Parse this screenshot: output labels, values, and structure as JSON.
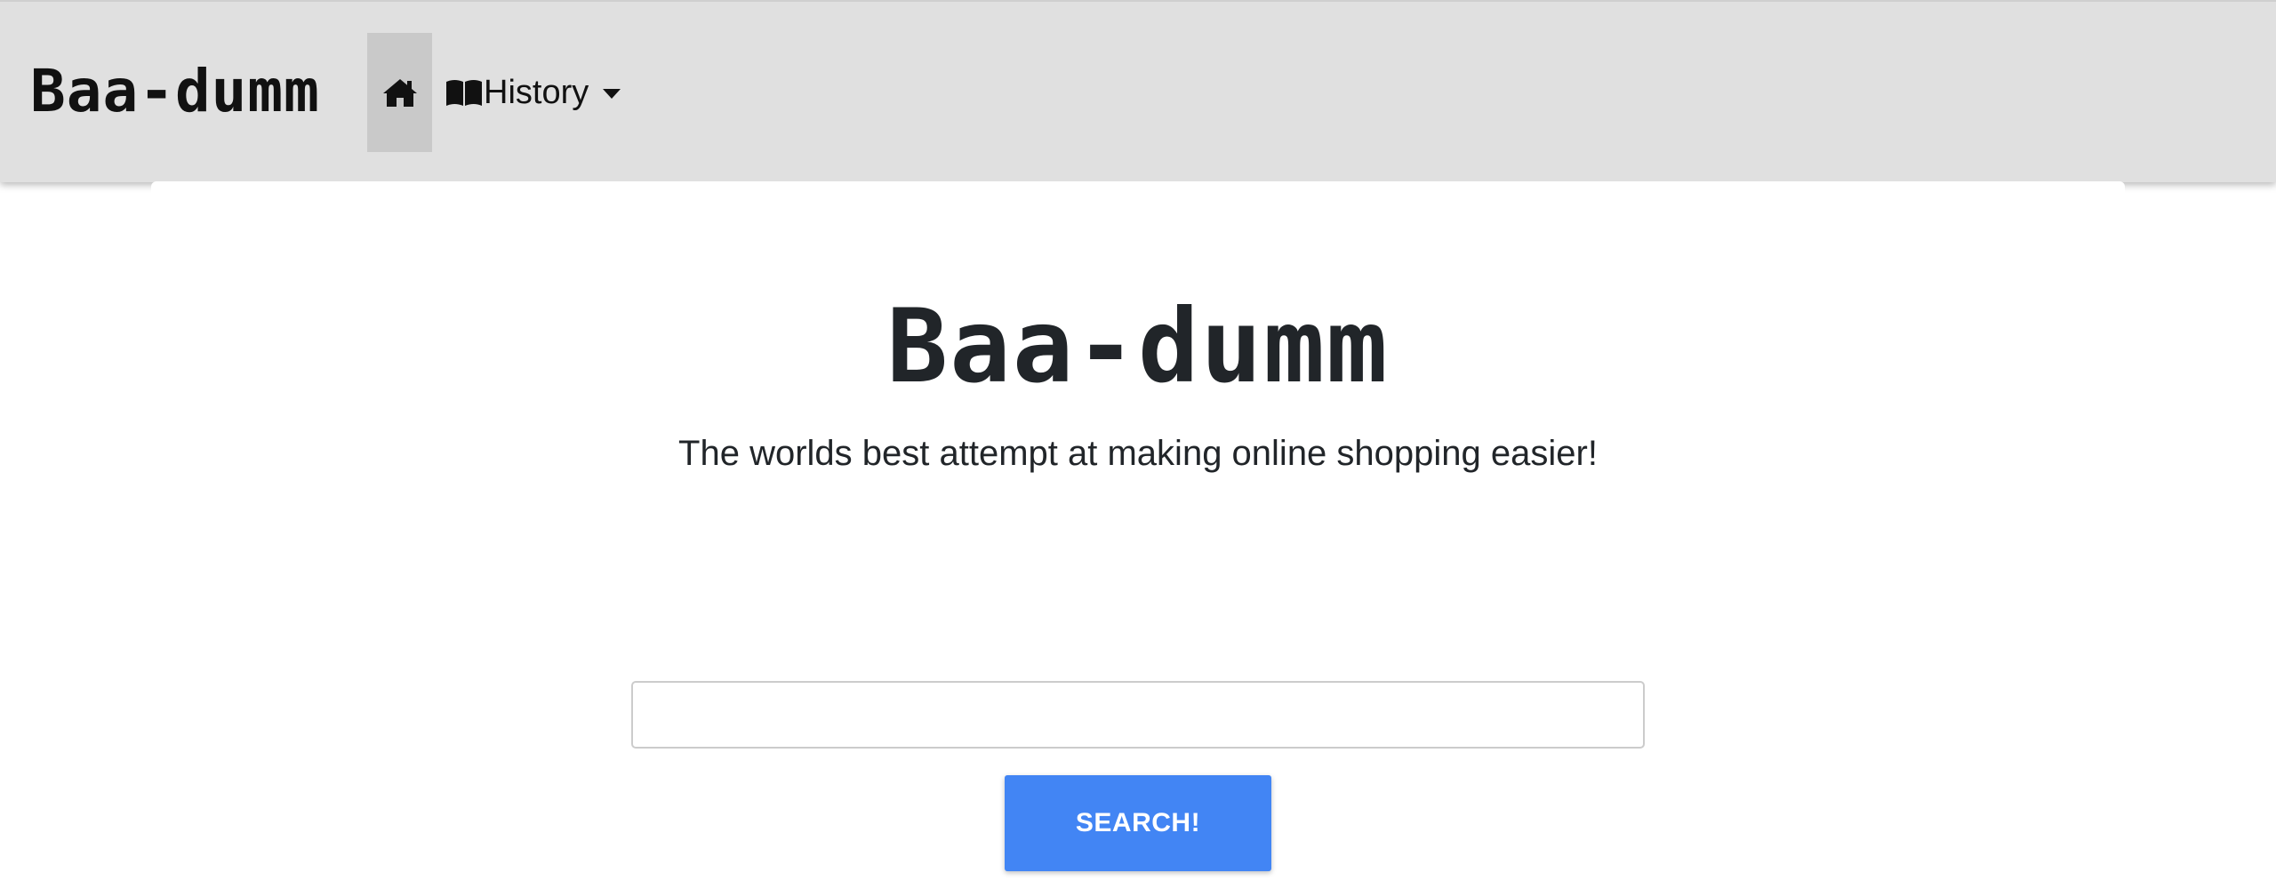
{
  "navbar": {
    "brand": "Baa-dumm",
    "home_icon": "home-icon",
    "history": {
      "icon": "book-icon",
      "label": "History",
      "caret_icon": "caret-down-icon"
    }
  },
  "hero": {
    "title": "Baa-dumm",
    "subtitle": "The worlds best attempt at making online shopping easier!"
  },
  "search": {
    "value": "",
    "button_label": "SEARCH!"
  },
  "colors": {
    "navbar_bg": "#e0e0e0",
    "home_active_bg": "#c9c9c9",
    "button_primary": "#4285f4",
    "text_dark": "#212529"
  }
}
